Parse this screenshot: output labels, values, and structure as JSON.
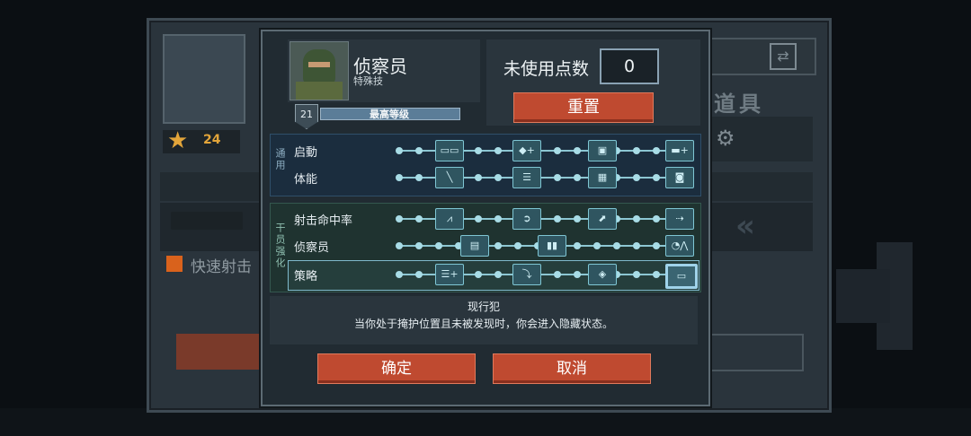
{
  "background": {
    "level": "24",
    "fast_fire_label": "快速射击",
    "items_title": "道具"
  },
  "profile": {
    "class_name": "侦察员",
    "subtitle": "特殊技",
    "level": "21",
    "level_bar_label": "最高等级"
  },
  "points": {
    "label": "未使用点数",
    "value": "0",
    "reset_label": "重置"
  },
  "groups": [
    {
      "tag": "通用",
      "rows": [
        {
          "label": "启動",
          "nodes": [
            "▭▭",
            "◆+",
            "▣",
            "▬+"
          ]
        },
        {
          "label": "体能",
          "nodes": [
            "╲",
            "☰",
            "▦",
            "◙"
          ]
        }
      ]
    },
    {
      "tag": "干员强化",
      "rows": [
        {
          "label": "射击命中率",
          "nodes": [
            "⩘",
            "➲",
            "⬈",
            "⇢"
          ]
        },
        {
          "label": "侦察员",
          "nodes": [
            "▤",
            "▮▮",
            "◔⋀"
          ]
        },
        {
          "label": "策略",
          "nodes": [
            "☰+",
            "⤵",
            "◈",
            "▭"
          ]
        }
      ]
    }
  ],
  "selected_skill": {
    "name": "现行犯",
    "description": "当你处于掩护位置且未被发现时，你会进入隐藏状态。"
  },
  "buttons": {
    "confirm": "确定",
    "cancel": "取消"
  }
}
